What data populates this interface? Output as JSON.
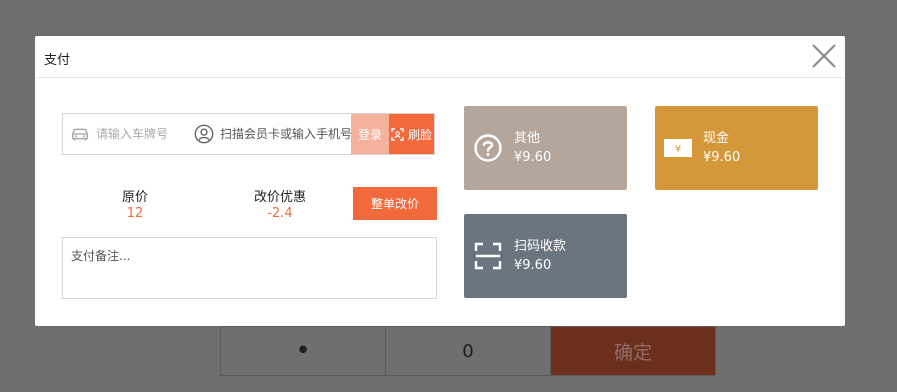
{
  "dialog": {
    "title": "支付"
  },
  "scan_row": {
    "plate_placeholder": "请输入车牌号",
    "member_placeholder": "扫描会员卡或输入手机号",
    "login_label": "登录",
    "refresh_label": "刷脸"
  },
  "prices": {
    "original_label": "原价",
    "original_value": "12",
    "discount_label": "改价优惠",
    "discount_value": "-2.4",
    "adjust_button": "整单改价"
  },
  "remarks": {
    "placeholder": "支付备注..."
  },
  "payments": [
    {
      "name": "其他",
      "amount": "¥9.60",
      "icon": "question-circle-icon",
      "color": "#b5a69c"
    },
    {
      "name": "现金",
      "amount": "¥9.60",
      "icon": "cash-note-icon",
      "color": "#d4983a"
    },
    {
      "name": "扫码收款",
      "amount": "¥9.60",
      "icon": "scan-frame-icon",
      "color": "#6b7580"
    }
  ],
  "background_keypad": {
    "keys": [
      "•",
      "0",
      "确定"
    ],
    "confirm_color": "#6b2f1c"
  },
  "colors": {
    "accent": "#f26a3c",
    "overlay": "#6e6e6e"
  }
}
